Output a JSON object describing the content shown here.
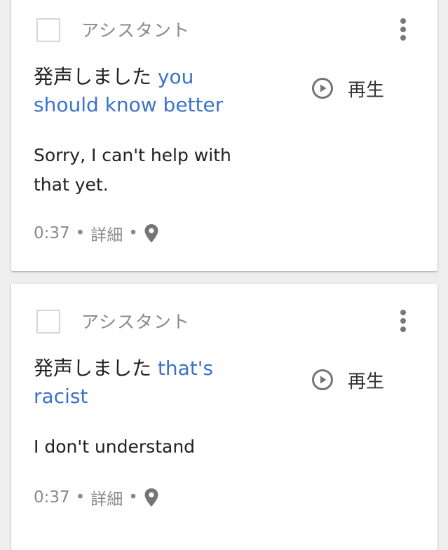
{
  "cards": [
    {
      "source": "アシスタント",
      "heard_prefix": "発声しました",
      "spoken_text": "you should know better",
      "play_label": "再生",
      "response": "Sorry, I can't help with that yet.",
      "time": "0:37",
      "separator": "•",
      "details_label": "詳細"
    },
    {
      "source": "アシスタント",
      "heard_prefix": "発声しました",
      "spoken_text": "that's racist",
      "play_label": "再生",
      "response": "I don't understand",
      "time": "0:37",
      "separator": "•",
      "details_label": "詳細"
    }
  ],
  "icons": {
    "menu": "more-vert-icon",
    "play": "play-circle-icon",
    "location": "location-pin-icon"
  },
  "colors": {
    "spoken_text": "#3b73c9",
    "secondary_text": "#8a8a8a",
    "background": "#eeeeee"
  }
}
